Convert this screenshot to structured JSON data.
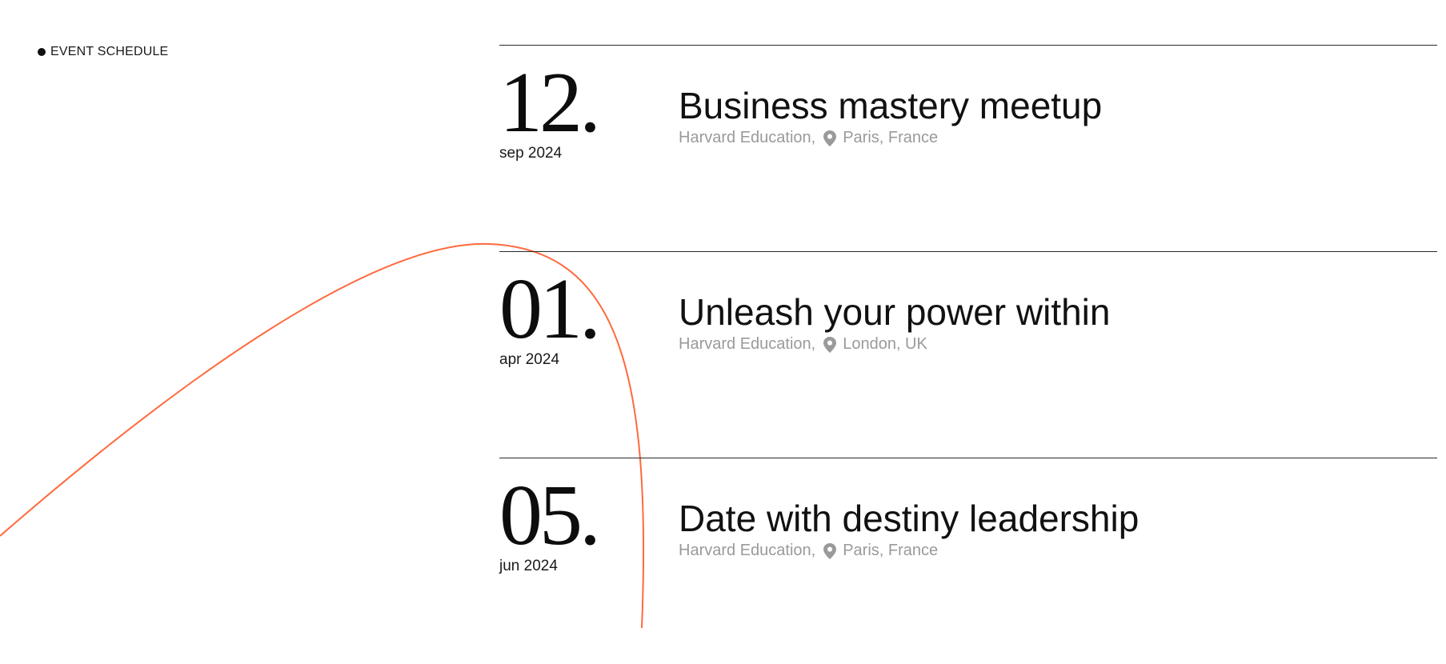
{
  "section": {
    "label": "EVENT SCHEDULE"
  },
  "events": [
    {
      "day": "12.",
      "month": "sep 2024",
      "title": "Business mastery meetup",
      "organizer": "Harvard Education,",
      "location": "Paris, France"
    },
    {
      "day": "01.",
      "month": "apr 2024",
      "title": "Unleash your power within",
      "organizer": "Harvard Education,",
      "location": "London, UK"
    },
    {
      "day": "05.",
      "month": "jun 2024",
      "title": "Date with destiny leadership",
      "organizer": "Harvard Education,",
      "location": "Paris, France"
    }
  ],
  "colors": {
    "accent_curve": "#ff6a3d",
    "muted_text": "#9a9a9a"
  },
  "icons": {
    "location": "map-pin-icon",
    "bullet": "dot-icon"
  }
}
